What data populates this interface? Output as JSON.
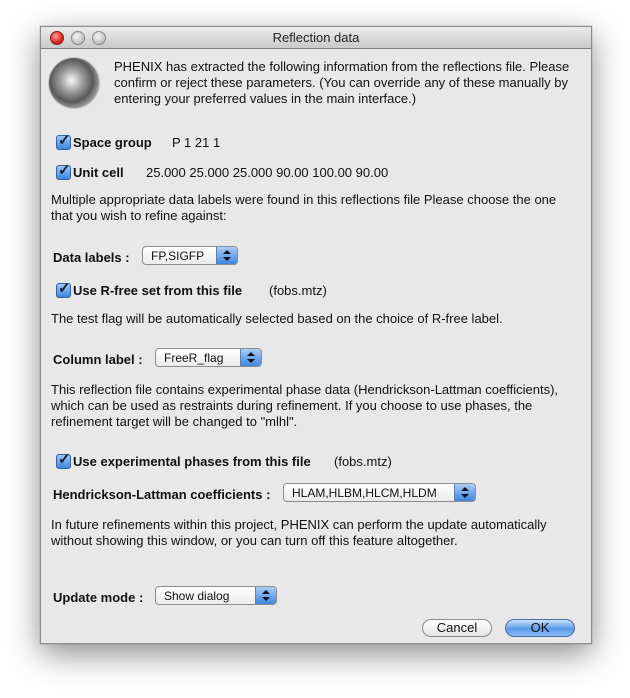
{
  "window": {
    "title": "Reflection data"
  },
  "intro": {
    "text": "PHENIX has extracted the following information from the reflections file. Please confirm or reject these parameters.  (You can override any of these manually by entering your preferred values in the main interface.)"
  },
  "space_group": {
    "label": "Space group",
    "value": "P 1 21 1",
    "checked": true
  },
  "unit_cell": {
    "label": "Unit cell",
    "value": "25.000 25.000 25.000  90.00 100.00 90.00",
    "checked": true
  },
  "multiple_labels_text": "Multiple appropriate data labels were found in this reflections file Please choose the one that you wish to refine against:",
  "data_labels": {
    "label": "Data labels :",
    "selected": "FP,SIGFP"
  },
  "rfree": {
    "label": "Use R-free set from this file",
    "file": "(fobs.mtz)",
    "checked": true
  },
  "test_flag_text": "The test flag will be automatically selected based on the choice of R-free label.",
  "column_label": {
    "label": "Column label :",
    "selected": "FreeR_flag"
  },
  "phase_text": "This reflection file contains experimental phase data (Hendrickson-Lattman coefficients), which can be used as restraints during refinement.  If you choose to use phases, the refinement target will be changed to \"mlhl\".",
  "exp_phases": {
    "label": "Use experimental phases from this file",
    "file": "(fobs.mtz)",
    "checked": true
  },
  "hl_coeffs": {
    "label": "Hendrickson-Lattman coefficients :",
    "selected": "HLAM,HLBM,HLCM,HLDM"
  },
  "future_text": "In future refinements within this project, PHENIX can perform the update automatically without showing this window, or you can turn off this feature altogether.",
  "update_mode": {
    "label": "Update mode :",
    "selected": "Show dialog"
  },
  "buttons": {
    "cancel": "Cancel",
    "ok": "OK"
  }
}
